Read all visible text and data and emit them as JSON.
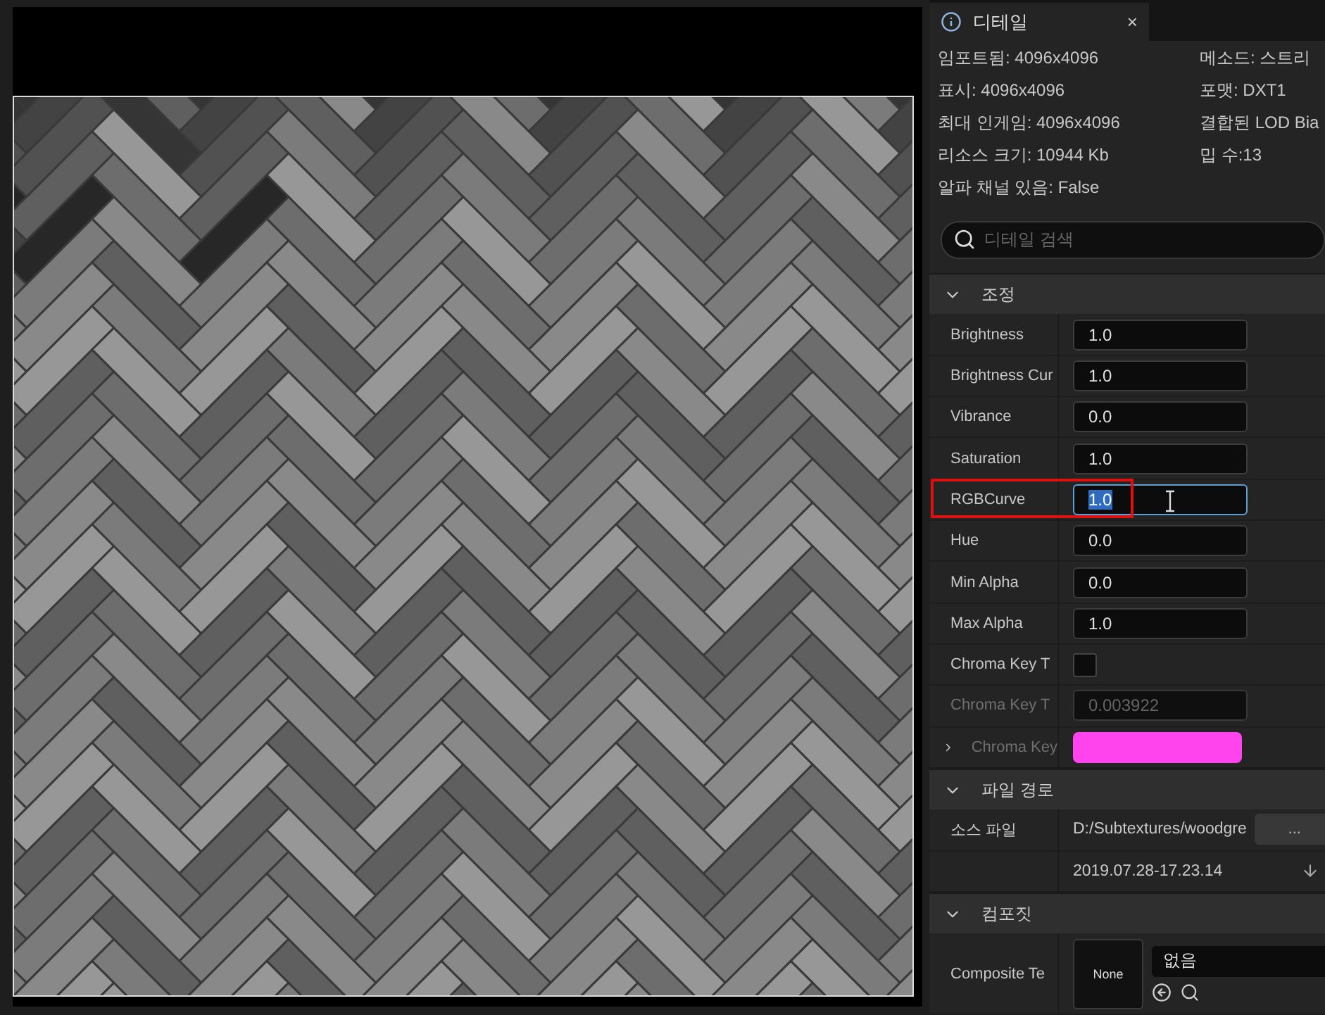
{
  "details_tab": {
    "title": "디테일",
    "close": "×",
    "selected": true
  },
  "info": {
    "left": [
      "임포트됨: 4096x4096",
      "표시: 4096x4096",
      "최대 인게임: 4096x4096",
      "리소스 크기: 10944 Kb",
      "알파 채널 있음: False"
    ],
    "right": [
      "메소드: 스트리",
      "포맷: DXT1",
      "결합된 LOD Bia",
      "밉 수:13"
    ]
  },
  "search": {
    "placeholder": "디테일 검색"
  },
  "sections": [
    {
      "title": "조정",
      "expanded": true,
      "rows": [
        {
          "kind": "number",
          "label": "Brightness",
          "value": "1.0",
          "disabled": false,
          "focused": false,
          "annotated": false
        },
        {
          "kind": "number",
          "label": "Brightness Cur",
          "value": "1.0",
          "disabled": false,
          "focused": false,
          "annotated": false
        },
        {
          "kind": "number",
          "label": "Vibrance",
          "value": "0.0",
          "disabled": false,
          "focused": false,
          "annotated": false
        },
        {
          "kind": "number",
          "label": "Saturation",
          "value": "1.0",
          "disabled": false,
          "focused": false,
          "annotated": false
        },
        {
          "kind": "number",
          "label": "RGBCurve",
          "value": "1.0",
          "disabled": false,
          "focused": true,
          "annotated": true
        },
        {
          "kind": "number",
          "label": "Hue",
          "value": "0.0",
          "disabled": false,
          "focused": false,
          "annotated": false
        },
        {
          "kind": "number",
          "label": "Min Alpha",
          "value": "0.0",
          "disabled": false,
          "focused": false,
          "annotated": false
        },
        {
          "kind": "number",
          "label": "Max Alpha",
          "value": "1.0",
          "disabled": false,
          "focused": false,
          "annotated": false
        },
        {
          "kind": "checkbox",
          "label": "Chroma Key T",
          "checked": false,
          "disabled": false
        },
        {
          "kind": "number",
          "label": "Chroma Key T",
          "value": "0.003922",
          "disabled": true,
          "focused": false,
          "annotated": false
        },
        {
          "kind": "color",
          "label": "Chroma Key",
          "color": "#ff44ee",
          "disabled": true,
          "expanded": false
        }
      ]
    },
    {
      "title": "파일 경로",
      "expanded": true,
      "rows": [
        {
          "kind": "file",
          "label": "소스 파일",
          "value": "D:/Subtextures/woodgre",
          "button": "..."
        },
        {
          "kind": "timestamp",
          "value": "2019.07.28-17.23.14"
        }
      ]
    },
    {
      "title": "컴포짓",
      "expanded": true,
      "rows": [
        {
          "kind": "composite",
          "label": "Composite Te",
          "thumb": "None",
          "dropdown": "없음"
        }
      ]
    }
  ]
}
